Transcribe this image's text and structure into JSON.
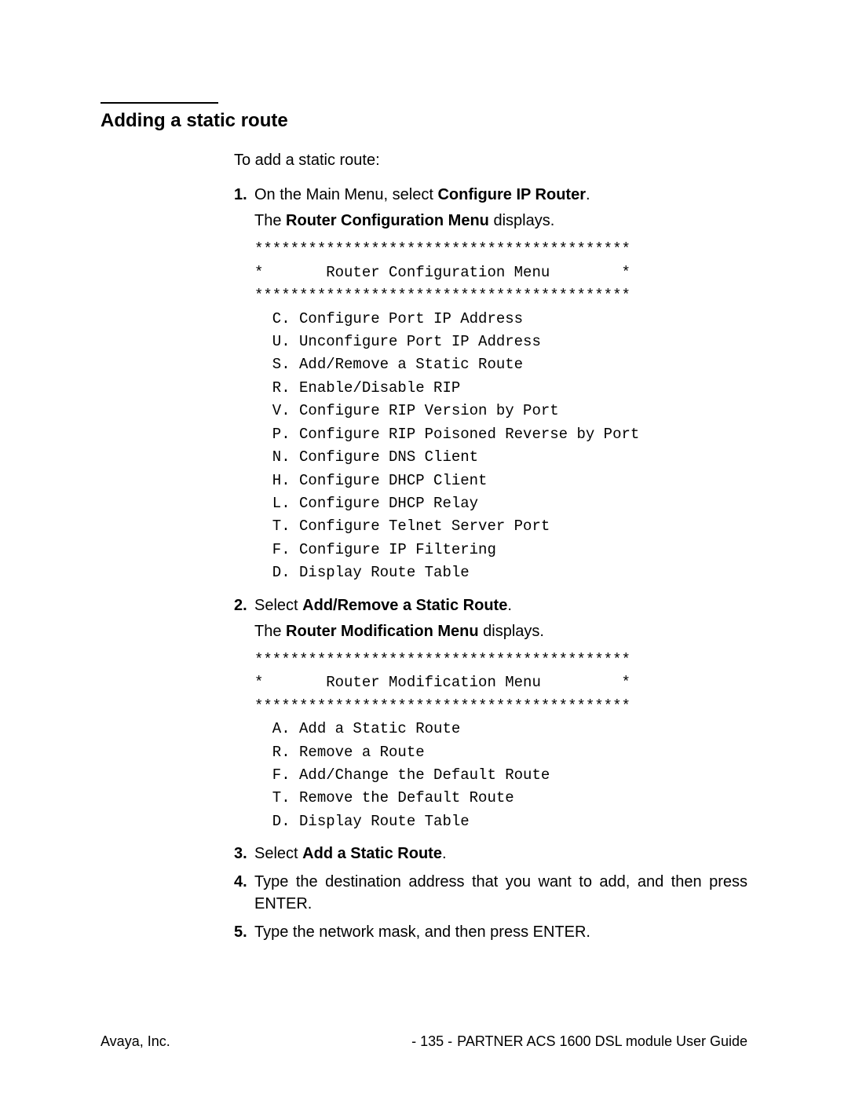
{
  "heading": "Adding a static route",
  "intro": "To add a static route:",
  "steps": {
    "s1": {
      "num": "1.",
      "prefix": "On the Main Menu, select ",
      "bold": "Configure IP Router",
      "suffix": "."
    },
    "s1b": {
      "prefix": "The ",
      "bold": "Router Configuration Menu",
      "suffix": " displays."
    },
    "menu1": "******************************************\n*       Router Configuration Menu        *\n******************************************\n  C. Configure Port IP Address\n  U. Unconfigure Port IP Address\n  S. Add/Remove a Static Route\n  R. Enable/Disable RIP\n  V. Configure RIP Version by Port\n  P. Configure RIP Poisoned Reverse by Port\n  N. Configure DNS Client\n  H. Configure DHCP Client\n  L. Configure DHCP Relay\n  T. Configure Telnet Server Port\n  F. Configure IP Filtering\n  D. Display Route Table",
    "s2": {
      "num": "2.",
      "prefix": "Select ",
      "bold": "Add/Remove a Static Route",
      "suffix": "."
    },
    "s2b": {
      "prefix": "The ",
      "bold": "Router Modification Menu",
      "suffix": " displays."
    },
    "menu2": "******************************************\n*       Router Modification Menu         *\n******************************************\n  A. Add a Static Route\n  R. Remove a Route\n  F. Add/Change the Default Route\n  T. Remove the Default Route\n  D. Display Route Table",
    "s3": {
      "num": "3.",
      "prefix": "Select ",
      "bold": "Add a Static Route",
      "suffix": "."
    },
    "s4": {
      "num": "4.",
      "text": "Type the destination address that you want to add, and then press ENTER."
    },
    "s5": {
      "num": "5.",
      "text": "Type the network mask, and then press ENTER."
    }
  },
  "footer": {
    "left": "Avaya, Inc.",
    "page": "- 135 -",
    "right": "PARTNER ACS 1600 DSL module User Guide"
  }
}
